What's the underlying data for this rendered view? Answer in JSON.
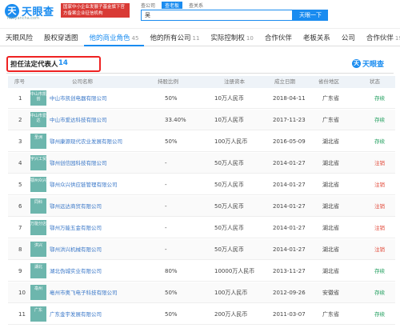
{
  "header": {
    "logo_glyph": "天",
    "logo_text": "天眼查",
    "logo_sub": "Tianyancha.com",
    "promo_text": "国家中小企业发展子基金旗下官方备案企业征信机构",
    "search_tabs": [
      "查公司",
      "查老板",
      "查关系"
    ],
    "active_search_tab": 1,
    "search_value": "吴",
    "search_button": "天眼一下"
  },
  "tabs": [
    {
      "label": "天眼风险",
      "count": ""
    },
    {
      "label": "股权穿透图",
      "count": ""
    },
    {
      "label": "他的商业角色",
      "count": "45"
    },
    {
      "label": "他的所有公司",
      "count": "11"
    },
    {
      "label": "实际控制权",
      "count": "10"
    },
    {
      "label": "合作伙伴",
      "count": ""
    },
    {
      "label": "老板关系",
      "count": ""
    },
    {
      "label": "公司",
      "count": ""
    },
    {
      "label": "合作伙伴",
      "count": "19"
    }
  ],
  "section": {
    "title": "担任法定代表人",
    "count": "14",
    "brand": "天眼查"
  },
  "table": {
    "columns": [
      "序号",
      "公司名称",
      "持股比例",
      "注册资本",
      "成立日期",
      "省份地区",
      "状态"
    ],
    "rows": [
      {
        "idx": "1",
        "logo": "中山市凯创",
        "name": "中山市凯创电器有限公司",
        "share": "50%",
        "capital": "10万人民币",
        "date": "2018-04-11",
        "region": "广东省",
        "status": "存续",
        "tone": "g"
      },
      {
        "idx": "2",
        "logo": "中山市爱达",
        "name": "中山市爱达科技有限公司",
        "share": "33.40%",
        "capital": "10万人民币",
        "date": "2017-11-23",
        "region": "广东省",
        "status": "存续",
        "tone": "g"
      },
      {
        "idx": "3",
        "logo": "圣洲",
        "name": "鄂州康源现代农业发展有限公司",
        "share": "50%",
        "capital": "100万人民币",
        "date": "2016-05-09",
        "region": "湖北省",
        "status": "存续",
        "tone": "g"
      },
      {
        "idx": "4",
        "logo": "宇兴工贸",
        "name": "鄂州创信园科技有限公司",
        "share": "-",
        "capital": "50万人民币",
        "date": "2014-01-27",
        "region": "湖北省",
        "status": "注销",
        "tone": "r"
      },
      {
        "idx": "5",
        "logo": "鄂州众兴",
        "name": "鄂州众兴供应链管理有限公司",
        "share": "-",
        "capital": "50万人民币",
        "date": "2014-01-27",
        "region": "湖北省",
        "status": "注销",
        "tone": "r"
      },
      {
        "idx": "6",
        "logo": "同科",
        "name": "鄂州远达商贸有限公司",
        "share": "-",
        "capital": "50万人民币",
        "date": "2014-01-27",
        "region": "湖北省",
        "status": "注销",
        "tone": "r"
      },
      {
        "idx": "7",
        "logo": "万能分店",
        "name": "鄂州万能五金有限公司",
        "share": "-",
        "capital": "50万人民币",
        "date": "2014-01-27",
        "region": "湖北省",
        "status": "注销",
        "tone": "r"
      },
      {
        "idx": "8",
        "logo": "洪兴",
        "name": "鄂州洪兴机械有限公司",
        "share": "-",
        "capital": "50万人民币",
        "date": "2014-01-27",
        "region": "湖北省",
        "status": "注销",
        "tone": "r"
      },
      {
        "idx": "9",
        "logo": "湖北",
        "name": "湖北伪城实业有限公司",
        "share": "80%",
        "capital": "10000万人民币",
        "date": "2013-11-27",
        "region": "湖北省",
        "status": "存续",
        "tone": "g"
      },
      {
        "idx": "10",
        "logo": "亳州",
        "name": "亳州市奥飞电子科技有限公司",
        "share": "50%",
        "capital": "100万人民币",
        "date": "2012-09-26",
        "region": "安徽省",
        "status": "存续",
        "tone": "g"
      },
      {
        "idx": "11",
        "logo": "广东",
        "name": "广东金宇发展有限公司",
        "share": "50%",
        "capital": "200万人民币",
        "date": "2011-03-07",
        "region": "广东省",
        "status": "存续",
        "tone": "g"
      }
    ]
  }
}
